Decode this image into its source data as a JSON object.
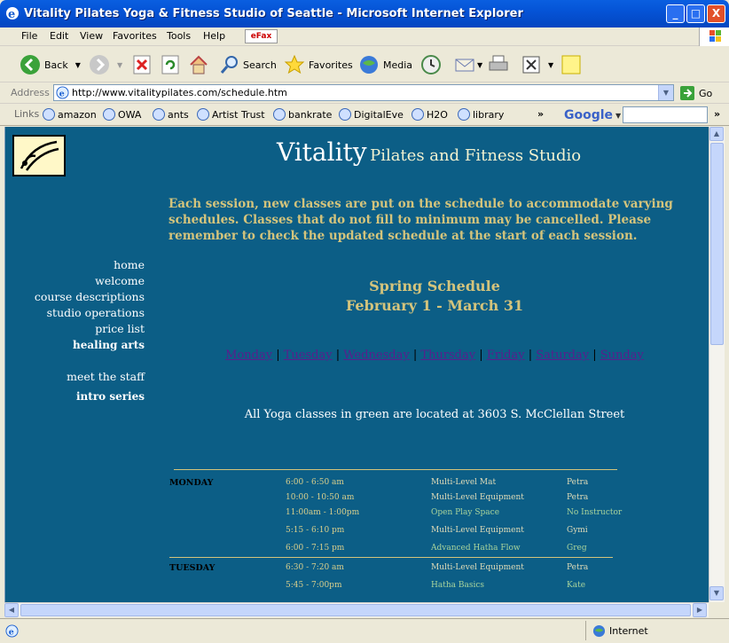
{
  "window": {
    "title": "Vitality Pilates Yoga & Fitness Studio of Seattle - Microsoft Internet Explorer",
    "min_label": "_",
    "max_label": "□",
    "close_label": "X"
  },
  "menu": [
    "File",
    "Edit",
    "View",
    "Favorites",
    "Tools",
    "Help"
  ],
  "efax_label": "eFax",
  "toolbar": {
    "back": "Back",
    "search": "Search",
    "favorites": "Favorites",
    "media": "Media"
  },
  "address": {
    "label": "Address",
    "url": "http://www.vitalitypilates.com/schedule.htm",
    "go": "Go"
  },
  "links": {
    "label": "Links",
    "items": [
      "amazon",
      "OWA",
      "ants",
      "Artist Trust",
      "bankrate",
      "DigitalEve",
      "H2O",
      "library"
    ],
    "google": "Google"
  },
  "page": {
    "brand_big": "Vitality",
    "brand_small": "Pilates and Fitness Studio",
    "intro": "Each session, new classes are put on the schedule to accommodate varying schedules. Classes that do not fill to minimum may be cancelled. Please remember to check the updated schedule at the start of each session.",
    "nav": [
      "home",
      "welcome",
      "course descriptions",
      "studio operations",
      "price list",
      "healing arts",
      "meet the staff",
      "intro series"
    ],
    "schedule_title": "Spring Schedule",
    "schedule_dates": "February 1 - March 31",
    "days": [
      "Monday",
      "Tuesday",
      "Wednesday",
      "Thursday",
      "Friday",
      "Saturday",
      "Sunday"
    ],
    "yoga_note": "All Yoga classes in green are located at 3603 S. McClellan Street",
    "monday": {
      "day": "MONDAY",
      "rows": [
        {
          "time": "6:00 - 6:50 am",
          "class": "Multi-Level Mat",
          "instructor": "Petra"
        },
        {
          "time": "10:00 - 10:50 am",
          "class": "Multi-Level Equipment",
          "instructor": "Petra"
        },
        {
          "time": "11:00am - 1:00pm",
          "class": "Open Play Space",
          "instructor": "No Instructor"
        },
        {
          "time": "5:15 - 6:10 pm",
          "class": "Multi-Level Equipment",
          "instructor": "Gymi"
        },
        {
          "time": "6:00 - 7:15 pm",
          "class": "Advanced Hatha Flow",
          "instructor": "Greg"
        }
      ]
    },
    "tuesday": {
      "day": "TUESDAY",
      "rows": [
        {
          "time": "6:30 - 7:20 am",
          "class": "Multi-Level Equipment",
          "instructor": "Petra"
        },
        {
          "time": "5:45 - 7:00pm",
          "class": "Hatha Basics",
          "instructor": "Kate"
        }
      ]
    }
  },
  "status": {
    "zone": "Internet"
  }
}
